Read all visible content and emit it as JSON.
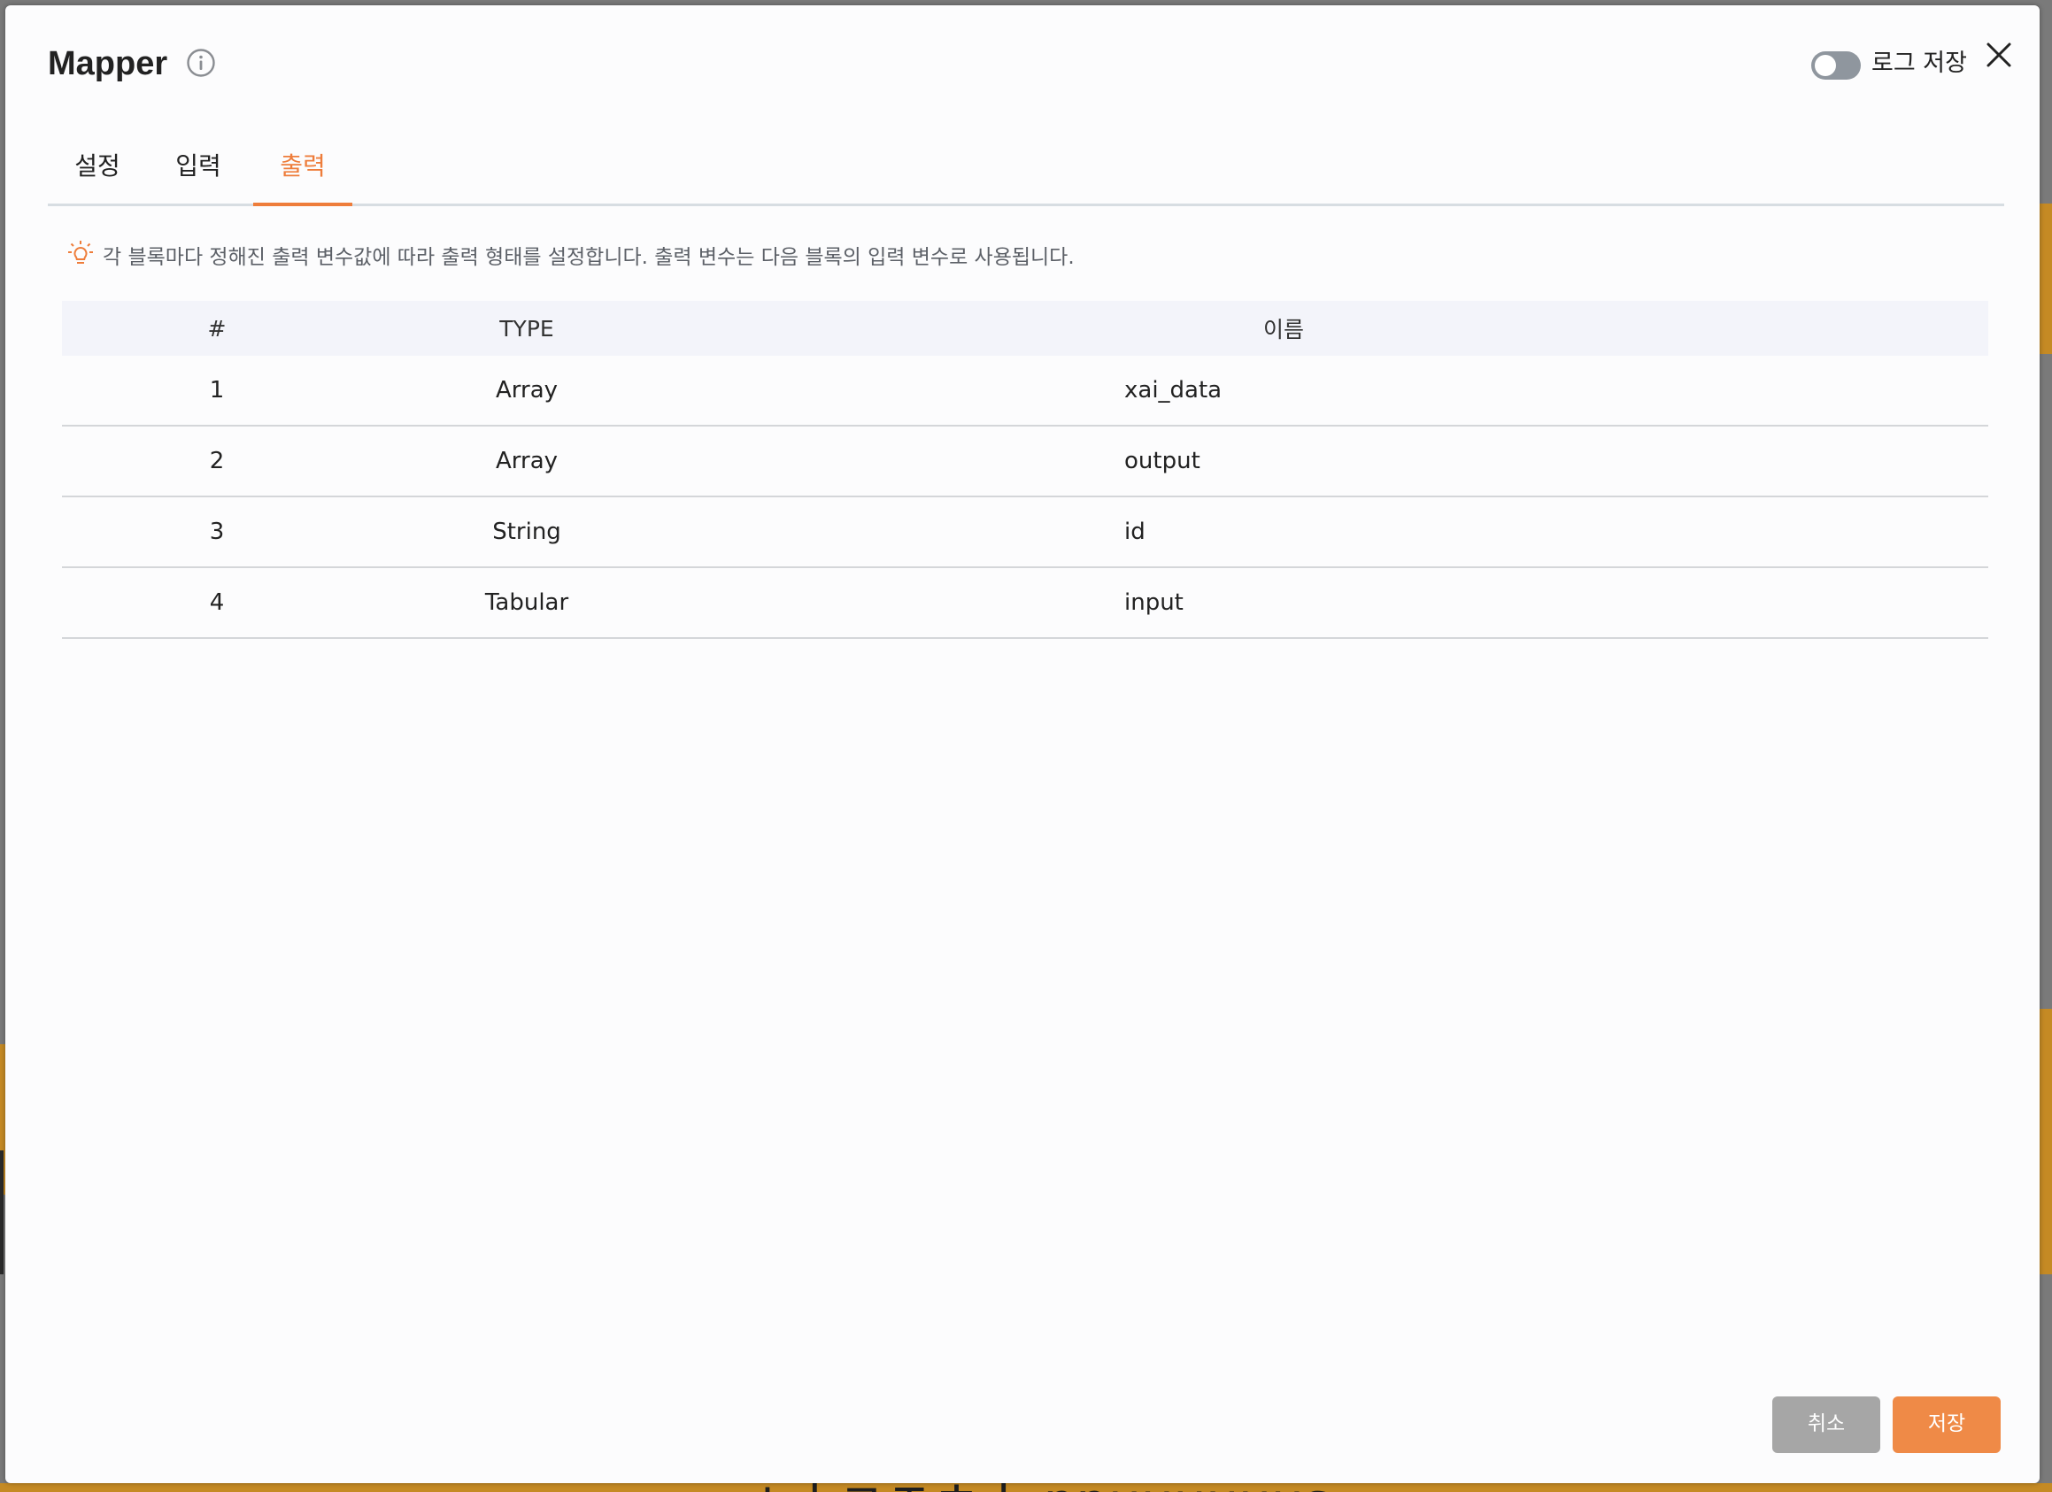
{
  "modal": {
    "title": "Mapper",
    "log_toggle_label": "로그 저장",
    "log_toggle_on": false
  },
  "tabs": [
    {
      "label": "설정",
      "active": false
    },
    {
      "label": "입력",
      "active": false
    },
    {
      "label": "출력",
      "active": true
    }
  ],
  "hint": "각 블록마다 정해진 출력 변수값에 따라 출력 형태를 설정합니다. 출력 변수는 다음 블록의 입력 변수로 사용됩니다.",
  "table": {
    "headers": [
      "#",
      "TYPE",
      "이름"
    ],
    "rows": [
      {
        "num": "1",
        "type": "Array",
        "name": "xai_data"
      },
      {
        "num": "2",
        "type": "Array",
        "name": "output"
      },
      {
        "num": "3",
        "type": "String",
        "name": "id"
      },
      {
        "num": "4",
        "type": "Tabular",
        "name": "input"
      }
    ]
  },
  "footer": {
    "cancel_label": "취소",
    "save_label": "저장"
  },
  "background": {
    "partial_text": "ㅅㅣㄱㅈㅎㅣ  ppuuuuuus"
  },
  "colors": {
    "accent": "#ee7d3b",
    "save_button": "#ef8a47",
    "cancel_button": "#a6a6a6",
    "table_header_bg": "#f3f4fa"
  }
}
